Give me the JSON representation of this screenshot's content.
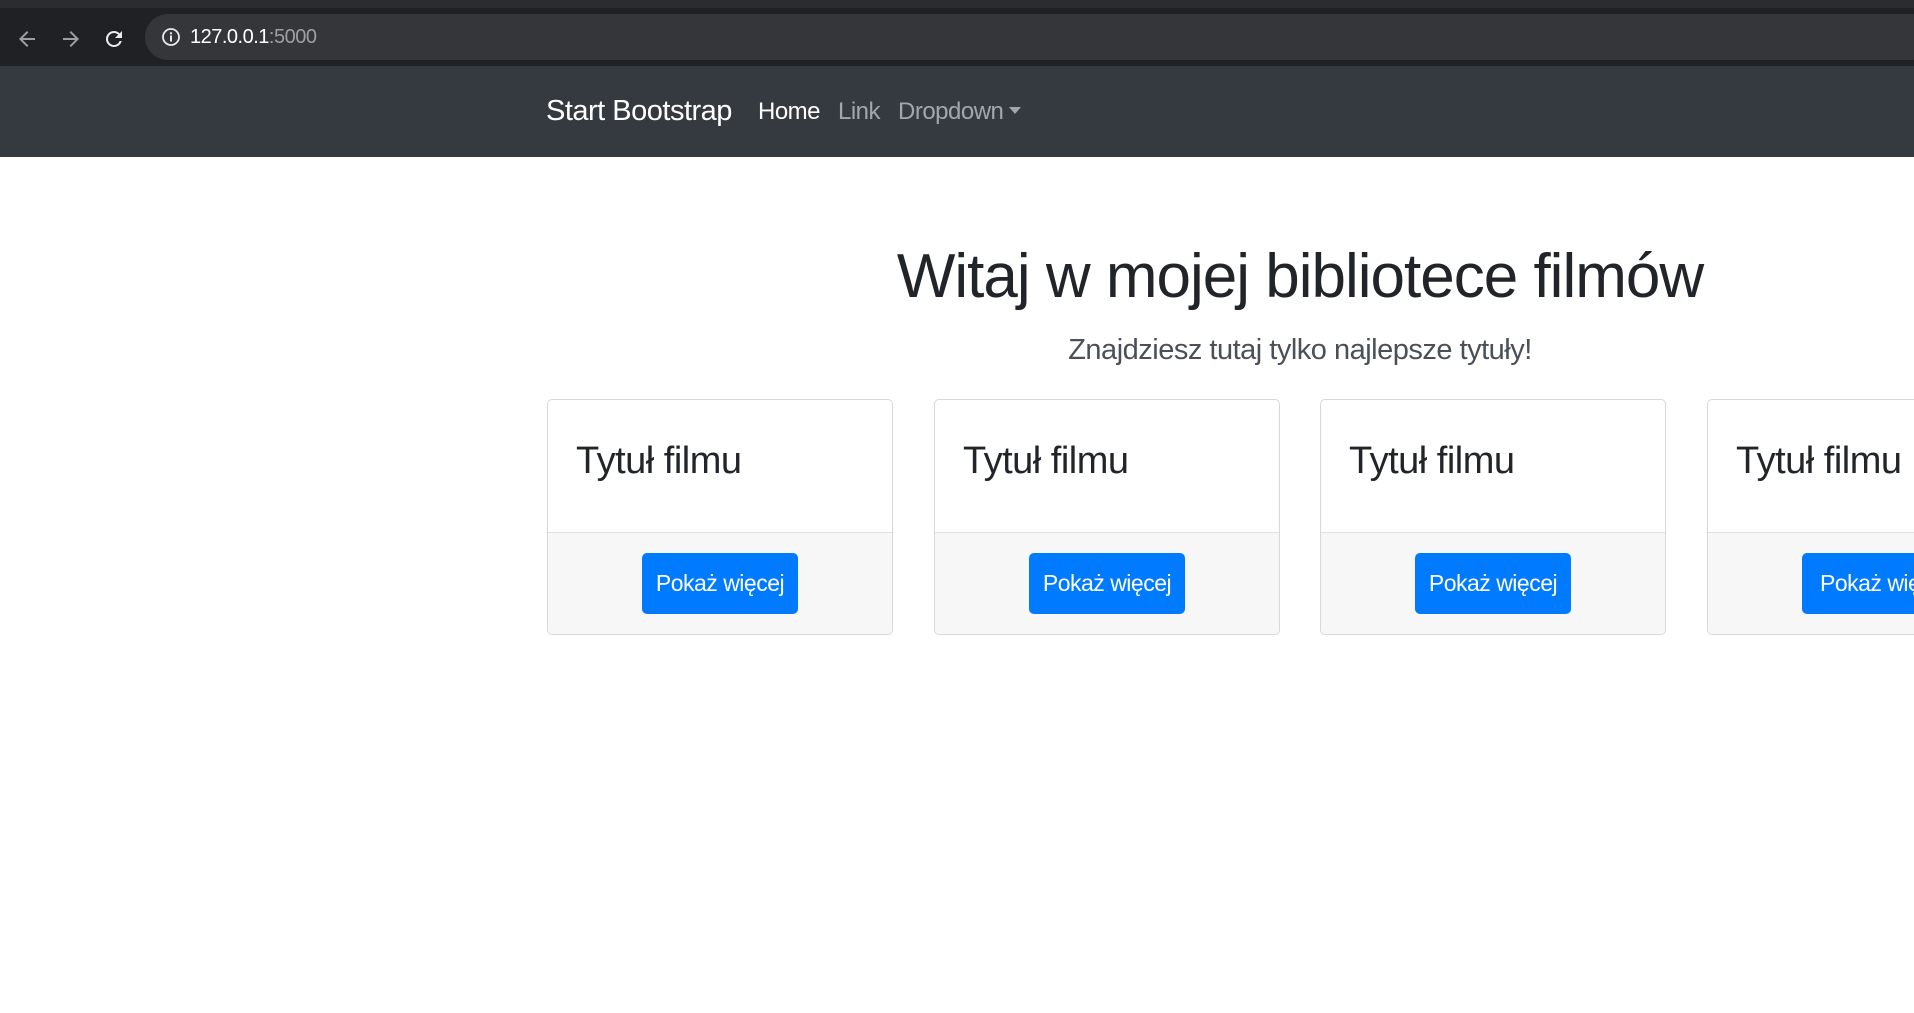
{
  "browser": {
    "url_host": "127.0.0.1",
    "url_port": ":5000"
  },
  "navbar": {
    "brand": "Start Bootstrap",
    "links": [
      {
        "label": "Home",
        "active": true
      },
      {
        "label": "Link",
        "active": false
      },
      {
        "label": "Dropdown",
        "active": false
      }
    ]
  },
  "hero": {
    "title": "Witaj w mojej bibliotece filmów",
    "subtitle": "Znajdziesz tutaj tylko najlepsze tytuły!"
  },
  "cards": [
    {
      "title": "Tytuł filmu",
      "button": "Pokaż więcej"
    },
    {
      "title": "Tytuł filmu",
      "button": "Pokaż więcej"
    },
    {
      "title": "Tytuł filmu",
      "button": "Pokaż więcej"
    },
    {
      "title": "Tytuł filmu",
      "button": "Pokaż więcej"
    }
  ],
  "colors": {
    "navbar_bg": "#343a40",
    "primary_button": "#007bff",
    "browser_toolbar": "#202124"
  },
  "icons": {
    "back": "back-arrow-icon",
    "forward": "forward-arrow-icon",
    "reload": "reload-icon",
    "site_info": "info-icon",
    "dropdown": "caret-down-icon"
  }
}
